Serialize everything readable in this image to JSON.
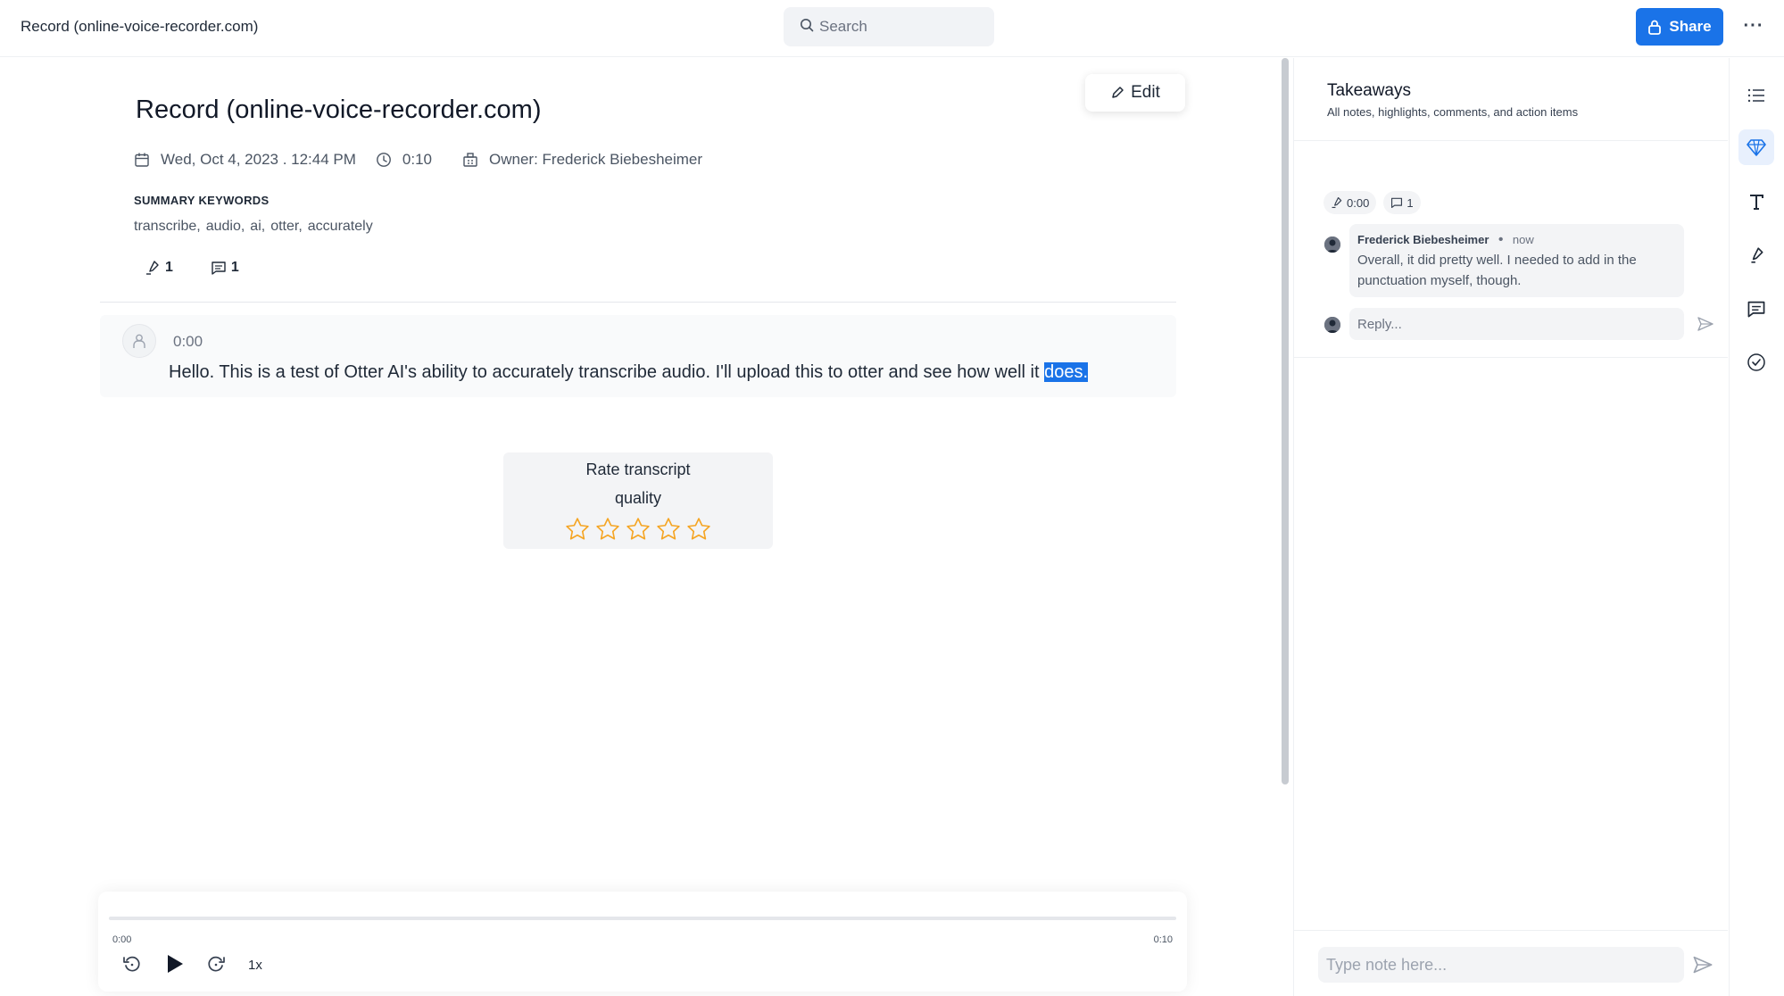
{
  "topbar": {
    "doc_title": "Record (online-voice-recorder.com)",
    "search_placeholder": "Search",
    "share_label": "Share",
    "more_label": "···",
    "accent_color": "#1a73e8"
  },
  "main": {
    "edit_label": "Edit",
    "title": "Record (online-voice-recorder.com)",
    "meta": {
      "date": "Wed, Oct 4, 2023 . 12:44 PM",
      "duration": "0:10",
      "owner": "Owner: Frederick Biebesheimer"
    },
    "keywords_heading": "SUMMARY KEYWORDS",
    "keywords": [
      "transcribe,",
      "audio,",
      "ai,",
      "otter,",
      "accurately"
    ],
    "highlight_count": "1",
    "comment_count": "1",
    "segment": {
      "time": "0:00",
      "text": "Hello. This is a test of Otter AI's ability to accurately transcribe audio. I'll upload this to otter and see how well it ",
      "highlighted": "does."
    },
    "rating": {
      "line1": "Rate transcript",
      "line2": "quality",
      "stars": 0,
      "max_stars": 5,
      "star_color": "#f5a524"
    }
  },
  "player": {
    "current": "0:00",
    "total": "0:10",
    "speed": "1x",
    "progress": 0
  },
  "panel": {
    "title": "Takeaways",
    "subtitle": "All notes, highlights, comments, and action items",
    "chip_time": "0:00",
    "chip_comments": "1",
    "comment": {
      "author": "Frederick Biebesheimer",
      "when": "now",
      "text": "Overall, it did pretty well. I needed to add in the punctuation myself, though."
    },
    "reply_placeholder": "Reply...",
    "note_placeholder": "Type note here..."
  },
  "rail": {
    "icons": [
      "outline-list-icon",
      "takeaways-diamond-icon",
      "text-format-icon",
      "highlight-marker-icon",
      "comments-icon",
      "action-items-check-icon"
    ],
    "active": "takeaways-diamond-icon"
  }
}
